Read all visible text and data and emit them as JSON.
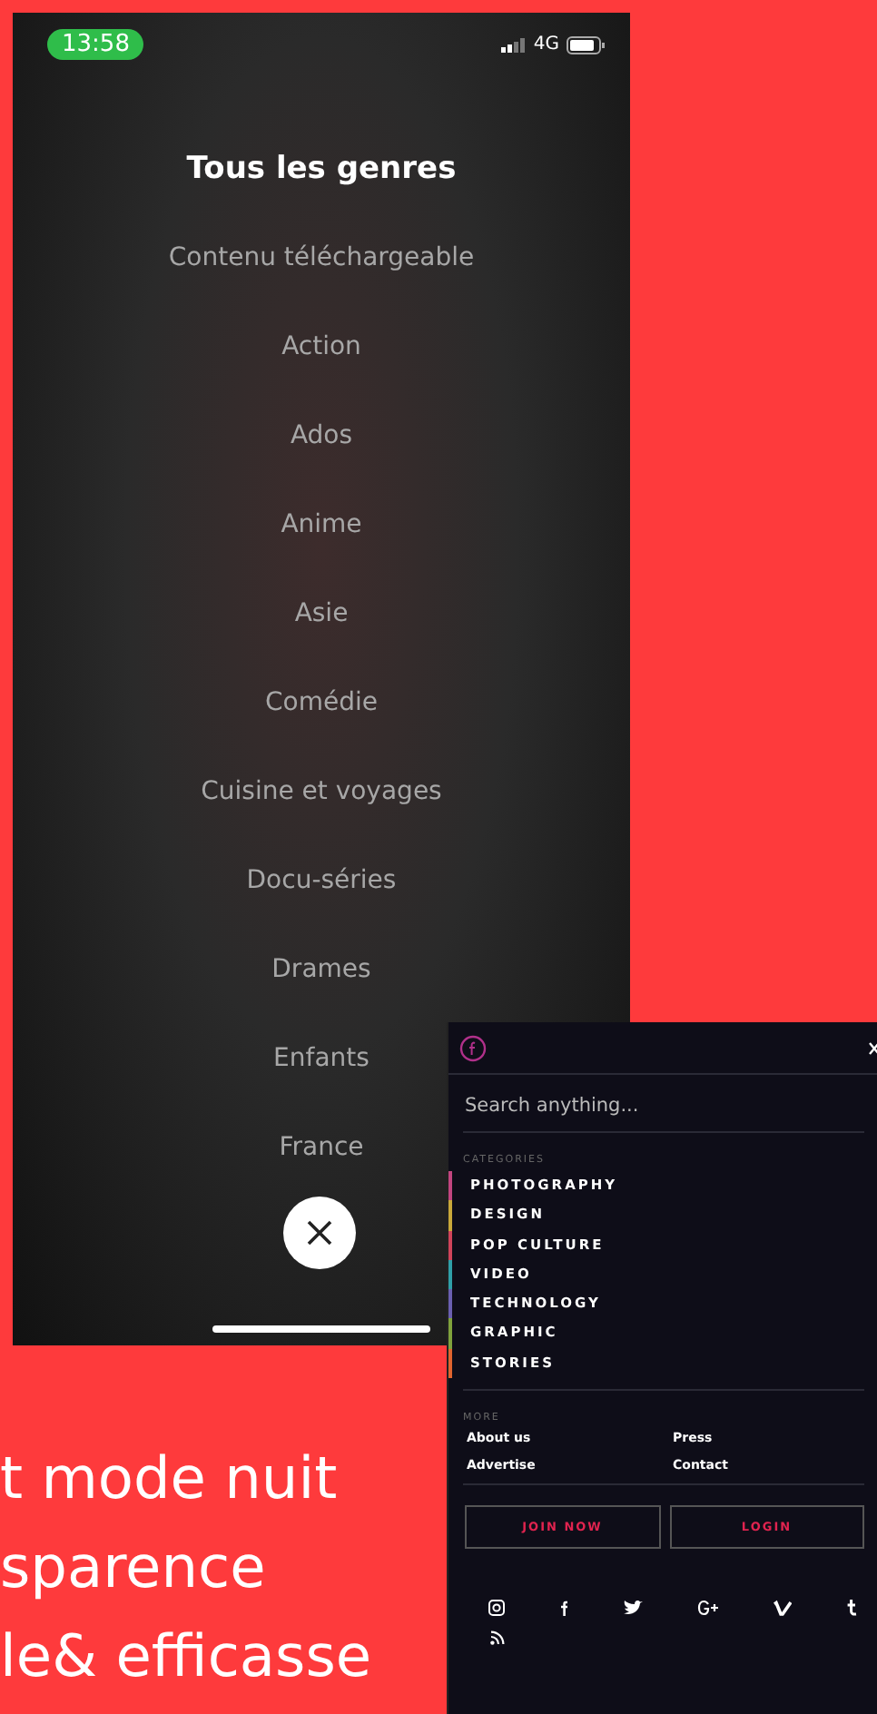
{
  "phone_screen": {
    "status_bar": {
      "time": "13:58",
      "network": "4G"
    },
    "title": "Tous les genres",
    "genres": [
      {
        "label": "Contenu téléchargeable"
      },
      {
        "label": "Action"
      },
      {
        "label": "Ados"
      },
      {
        "label": "Anime"
      },
      {
        "label": "Asie"
      },
      {
        "label": "Comédie"
      },
      {
        "label": "Cuisine et voyages"
      },
      {
        "label": "Docu-séries"
      },
      {
        "label": "Drames"
      },
      {
        "label": "Enfants"
      },
      {
        "label": "France"
      }
    ]
  },
  "menu_screen": {
    "search": {
      "placeholder": "Search anything..."
    },
    "categories_label": "CATEGORIES",
    "categories": [
      {
        "label": "PHOTOGRAPHY",
        "color": "#c2457f"
      },
      {
        "label": "DESIGN",
        "color": "#c9a83a"
      },
      {
        "label": "POP CULTURE",
        "color": "#d0435a"
      },
      {
        "label": "VIDEO",
        "color": "#2f9fa8"
      },
      {
        "label": "TECHNOLOGY",
        "color": "#6a5fb0"
      },
      {
        "label": "GRAPHIC",
        "color": "#7fa13c"
      },
      {
        "label": "STORIES",
        "color": "#e0642e"
      }
    ],
    "more_label": "MORE",
    "links": [
      "About us",
      "Press",
      "Advertise",
      "Contact"
    ],
    "buttons": [
      "JOIN NOW",
      "LOGIN"
    ]
  },
  "caption_lines": [
    "t mode nuit",
    "sparence",
    "le& efficasse"
  ]
}
